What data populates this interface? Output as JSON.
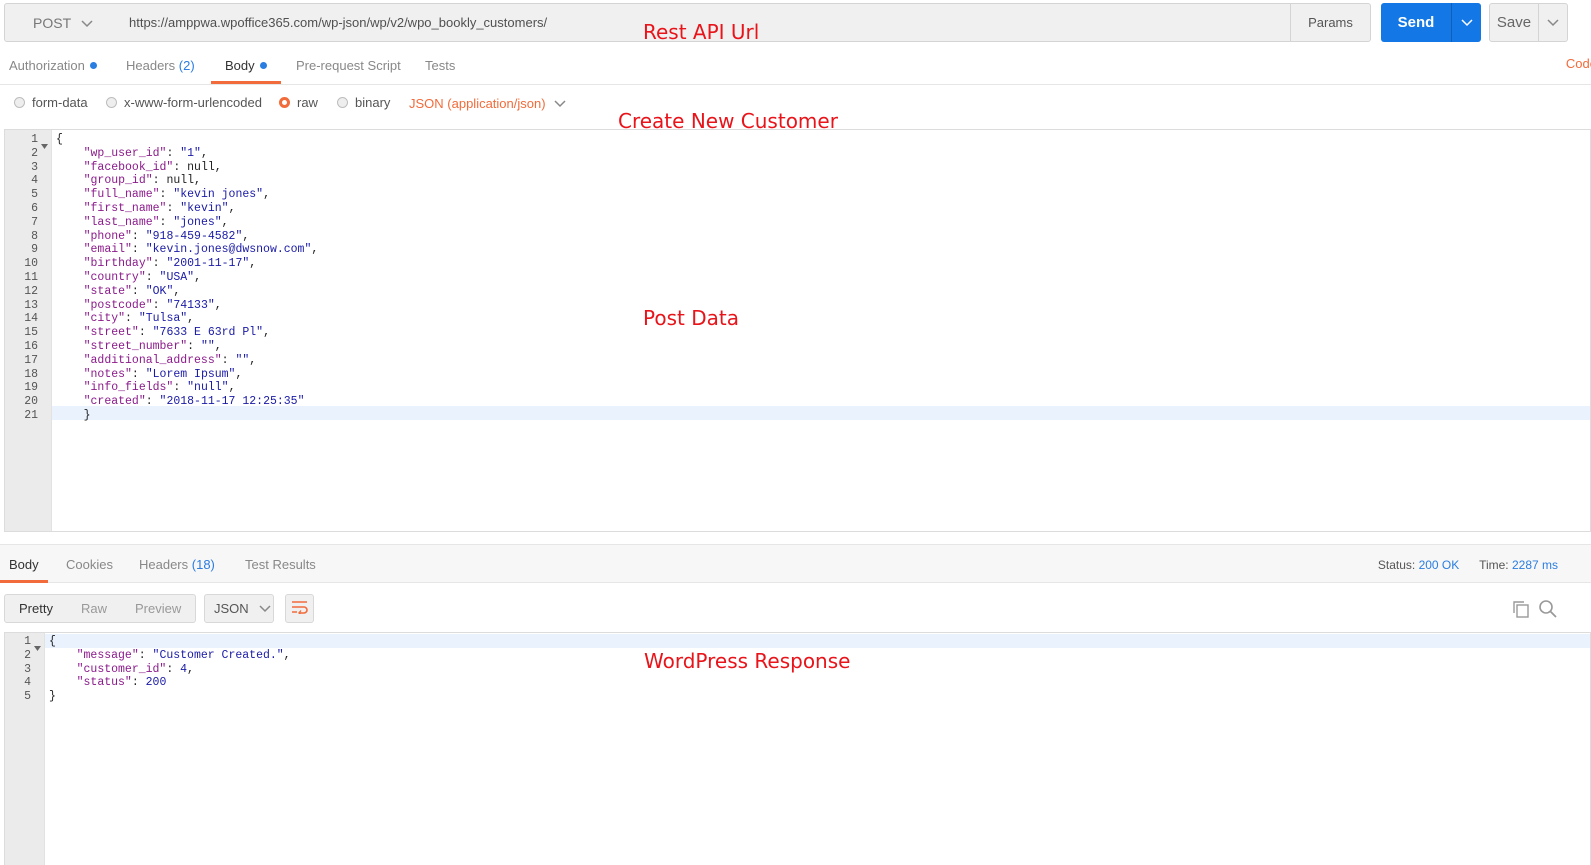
{
  "request": {
    "method": "POST",
    "url": "https://amppwa.wpoffice365.com/wp-json/wp/v2/wpo_bookly_customers/",
    "params_label": "Params",
    "send_label": "Send",
    "save_label": "Save"
  },
  "req_tabs": {
    "authorization": "Authorization",
    "headers": "Headers",
    "headers_count": "(2)",
    "body": "Body",
    "prerequest": "Pre-request Script",
    "tests": "Tests",
    "code": "Code"
  },
  "body_options": {
    "form_data": "form-data",
    "urlencoded": "x-www-form-urlencoded",
    "raw": "raw",
    "binary": "binary",
    "content_type": "JSON (application/json)"
  },
  "request_body_lines": [
    {
      "n": "1",
      "text": "{"
    },
    {
      "n": "2",
      "key": "\"wp_user_id\"",
      "val": "\"1\"",
      "type": "s"
    },
    {
      "n": "3",
      "key": "\"facebook_id\"",
      "val": "null",
      "type": "n"
    },
    {
      "n": "4",
      "key": "\"group_id\"",
      "val": "null",
      "type": "n"
    },
    {
      "n": "5",
      "key": "\"full_name\"",
      "val": "\"kevin jones\"",
      "type": "s"
    },
    {
      "n": "6",
      "key": "\"first_name\"",
      "val": "\"kevin\"",
      "type": "s"
    },
    {
      "n": "7",
      "key": "\"last_name\"",
      "val": "\"jones\"",
      "type": "s"
    },
    {
      "n": "8",
      "key": "\"phone\"",
      "val": "\"918-459-4582\"",
      "type": "s"
    },
    {
      "n": "9",
      "key": "\"email\"",
      "val": "\"kevin.jones@dwsnow.com\"",
      "type": "s"
    },
    {
      "n": "10",
      "key": "\"birthday\"",
      "val": "\"2001-11-17\"",
      "type": "s"
    },
    {
      "n": "11",
      "key": "\"country\"",
      "val": "\"USA\"",
      "type": "s"
    },
    {
      "n": "12",
      "key": "\"state\"",
      "val": "\"OK\"",
      "type": "s"
    },
    {
      "n": "13",
      "key": "\"postcode\"",
      "val": "\"74133\"",
      "type": "s"
    },
    {
      "n": "14",
      "key": "\"city\"",
      "val": "\"Tulsa\"",
      "type": "s"
    },
    {
      "n": "15",
      "key": "\"street\"",
      "val": "\"7633 E 63rd Pl\"",
      "type": "s"
    },
    {
      "n": "16",
      "key": "\"street_number\"",
      "val": "\"\"",
      "type": "s"
    },
    {
      "n": "17",
      "key": "\"additional_address\"",
      "val": "\"\"",
      "type": "s"
    },
    {
      "n": "18",
      "key": "\"notes\"",
      "val": "\"Lorem Ipsum\"",
      "type": "s"
    },
    {
      "n": "19",
      "key": "\"info_fields\"",
      "val": "\"null\"",
      "type": "s"
    },
    {
      "n": "20",
      "key": "\"created\"",
      "val": "\"2018-11-17 12:25:35\"",
      "type": "s",
      "last": true
    },
    {
      "n": "21",
      "text": "    }"
    }
  ],
  "resp_tabs": {
    "body": "Body",
    "cookies": "Cookies",
    "headers": "Headers",
    "headers_count": "(18)",
    "test_results": "Test Results"
  },
  "status": {
    "status_label": "Status:",
    "status_value": "200 OK",
    "time_label": "Time:",
    "time_value": "2287 ms"
  },
  "view": {
    "pretty": "Pretty",
    "raw": "Raw",
    "preview": "Preview",
    "format": "JSON"
  },
  "response_body_lines": [
    {
      "n": "1",
      "text": "{"
    },
    {
      "n": "2",
      "key": "\"message\"",
      "val": "\"Customer Created.\"",
      "type": "s"
    },
    {
      "n": "3",
      "key": "\"customer_id\"",
      "val": "4",
      "type": "num"
    },
    {
      "n": "4",
      "key": "\"status\"",
      "val": "200",
      "type": "num",
      "last": true
    },
    {
      "n": "5",
      "text": "}"
    }
  ],
  "annotations": {
    "rest_api_url": "Rest API Url",
    "create_new_customer": "Create New Customer",
    "post_data": "Post Data",
    "wordpress_response": "WordPress Response"
  },
  "colors": {
    "accent_orange": "#f26b3a",
    "send_blue": "#1378e6",
    "annotation_red": "#e8141a"
  },
  "icons": [
    "chevron-down-icon",
    "wrap-lines-icon",
    "copy-icon",
    "search-icon"
  ]
}
